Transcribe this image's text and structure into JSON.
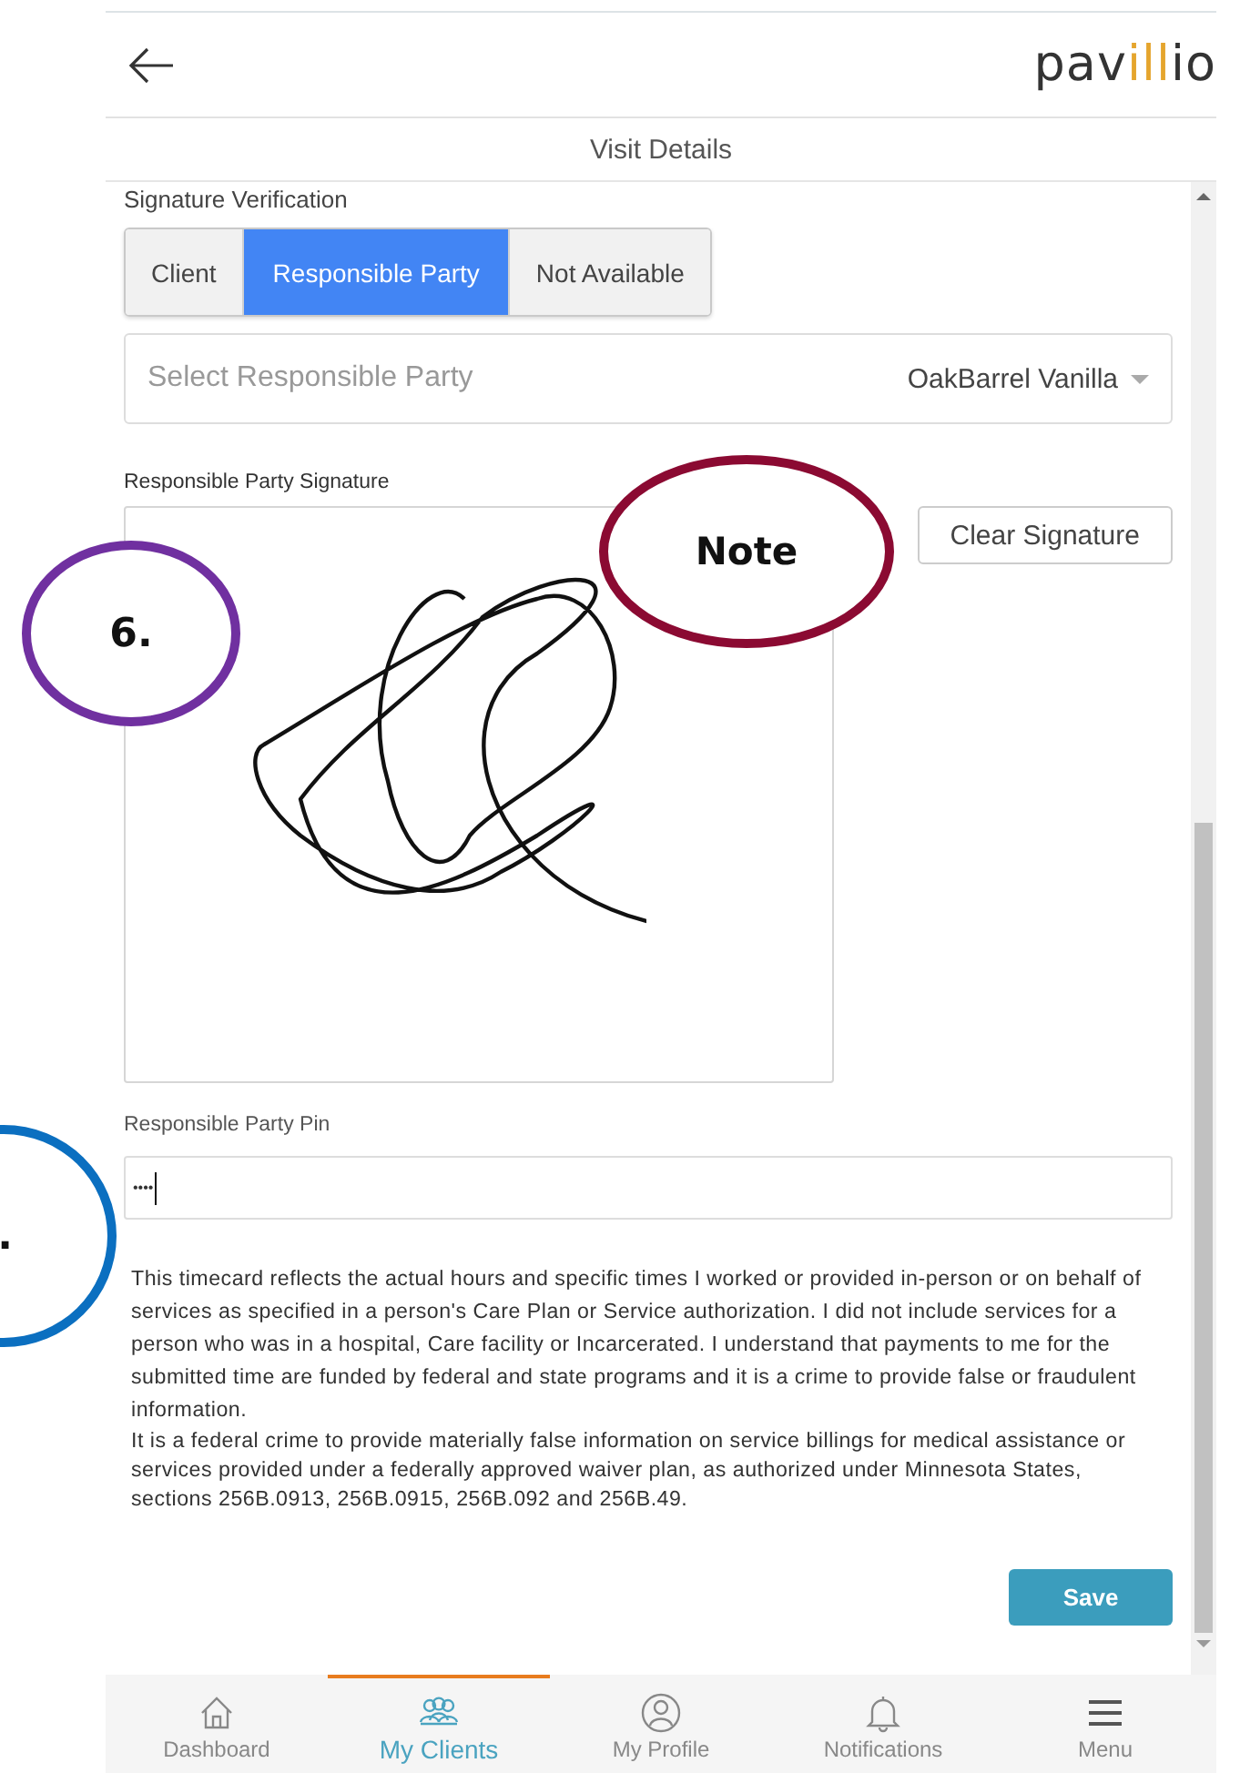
{
  "header": {
    "logo": [
      {
        "text": "pav",
        "accent": false
      },
      {
        "text": "ill",
        "accent": true
      },
      {
        "text": "io",
        "accent": false
      }
    ],
    "title": "Visit Details"
  },
  "section_heading": "Signature Verification",
  "signer_tabs": [
    {
      "label": "Client",
      "selected": false
    },
    {
      "label": "Responsible Party",
      "selected": true
    },
    {
      "label": "Not Available",
      "selected": false
    }
  ],
  "party_select": {
    "placeholder": "Select Responsible Party",
    "value": "OakBarrel Vanilla"
  },
  "signature": {
    "label": "Responsible Party Signature",
    "clear_button": "Clear Signature"
  },
  "pin": {
    "label": "Responsible Party Pin",
    "value": "••••"
  },
  "disclaimer": [
    "This timecard reflects the actual hours and specific times I worked or provided in-person or on behalf of services as specified in a person's Care Plan or Service authorization. I did not include services for a person who was in a hospital, Care facility or Incarcerated. I understand that payments to me for the submitted time are funded by federal and state programs and it is a crime to provide false or fraudulent information.",
    "It is a federal crime to provide materially false information on service billings for medical assistance or services provided under a federally approved waiver plan, as authorized under Minnesota States, sections 256B.0913, 256B.0915, 256B.092 and 256B.49."
  ],
  "save_button": "Save",
  "nav": [
    {
      "label": "Dashboard",
      "kind": "home",
      "selected": false
    },
    {
      "label": "My Clients",
      "kind": "group",
      "selected": true
    },
    {
      "label": "My Profile",
      "kind": "profile",
      "selected": false
    },
    {
      "label": "Notifications",
      "kind": "bell",
      "selected": false
    },
    {
      "label": "Menu",
      "kind": "menu",
      "selected": false
    }
  ],
  "annotations": [
    {
      "text": "6.",
      "color": "#7030a0"
    },
    {
      "text": "Note",
      "color": "#8b0a32"
    },
    {
      "text": ".",
      "color": "#0b6fc0"
    }
  ]
}
